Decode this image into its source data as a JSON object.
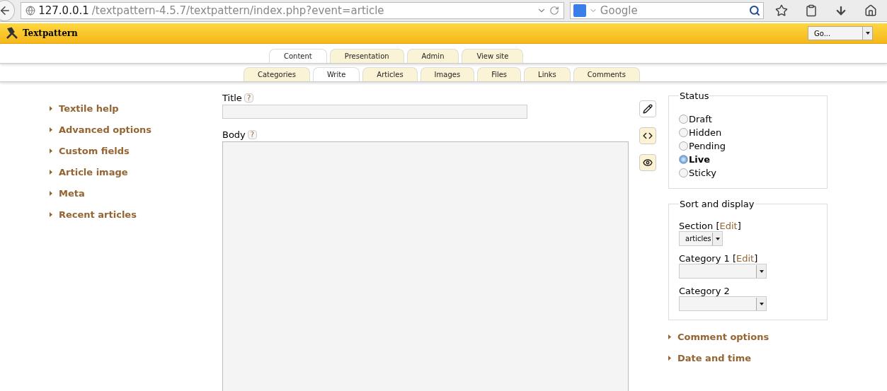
{
  "browser": {
    "url_host": "127.0.0.1",
    "url_path": "/textpattern-4.5.7/textpattern/index.php?event=article",
    "search_placeholder": "Google"
  },
  "header": {
    "brand": "Textpattern",
    "jump": "Go..."
  },
  "primary_tabs": [
    {
      "label": "Content",
      "selected": true
    },
    {
      "label": "Presentation",
      "selected": false
    },
    {
      "label": "Admin",
      "selected": false
    },
    {
      "label": "View site",
      "selected": false
    }
  ],
  "secondary_tabs": [
    {
      "label": "Categories",
      "selected": false
    },
    {
      "label": "Write",
      "selected": true
    },
    {
      "label": "Articles",
      "selected": false
    },
    {
      "label": "Images",
      "selected": false
    },
    {
      "label": "Files",
      "selected": false
    },
    {
      "label": "Links",
      "selected": false
    },
    {
      "label": "Comments",
      "selected": false
    }
  ],
  "sidebar": {
    "items": [
      "Textile help",
      "Advanced options",
      "Custom fields",
      "Article image",
      "Meta",
      "Recent articles"
    ]
  },
  "editor": {
    "title_label": "Title",
    "body_label": "Body",
    "help": "?"
  },
  "view_modes": [
    {
      "kind": "edit",
      "selected": true
    },
    {
      "kind": "html",
      "selected": false
    },
    {
      "kind": "preview",
      "selected": false
    }
  ],
  "status": {
    "legend": "Status",
    "options": [
      {
        "label": "Draft",
        "selected": false
      },
      {
        "label": "Hidden",
        "selected": false
      },
      {
        "label": "Pending",
        "selected": false
      },
      {
        "label": "Live",
        "selected": true
      },
      {
        "label": "Sticky",
        "selected": false
      }
    ]
  },
  "sort_display": {
    "legend": "Sort and display",
    "fields": [
      {
        "label": "Section",
        "open": "[",
        "edit": "Edit",
        "close": "]",
        "value": "articles"
      },
      {
        "label": "Category 1",
        "open": "[",
        "edit": "Edit",
        "close": "]"
      },
      {
        "label": "Category 2"
      }
    ]
  },
  "more_sections": [
    "Comment options",
    "Date and time"
  ]
}
